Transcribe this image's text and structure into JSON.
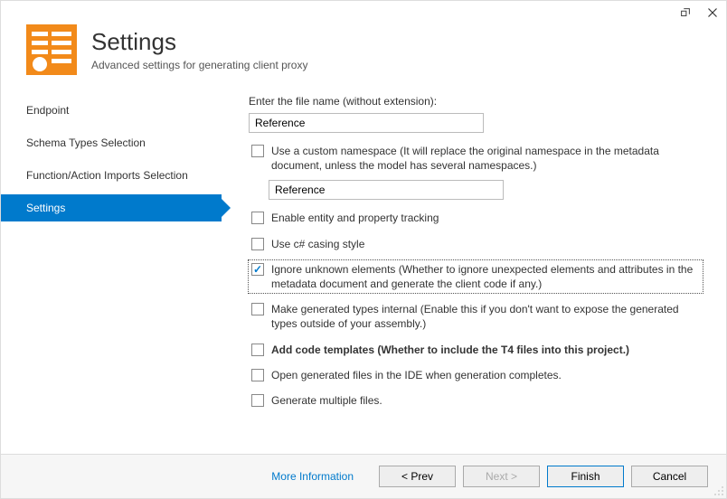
{
  "header": {
    "title": "Settings",
    "subtitle": "Advanced settings for generating client proxy"
  },
  "sidebar": {
    "items": [
      {
        "label": "Endpoint"
      },
      {
        "label": "Schema Types Selection"
      },
      {
        "label": "Function/Action Imports Selection"
      },
      {
        "label": "Settings"
      }
    ],
    "active_index": 3
  },
  "content": {
    "file_label": "Enter the file name (without extension):",
    "file_value": "Reference",
    "options": [
      {
        "key": "custom_ns",
        "label": "Use a custom namespace (It will replace the original namespace in the metadata document, unless the model has several namespaces.)",
        "checked": false,
        "input_value": "Reference"
      },
      {
        "key": "tracking",
        "label": "Enable entity and property tracking",
        "checked": false
      },
      {
        "key": "casing",
        "label": "Use c# casing style",
        "checked": false
      },
      {
        "key": "ignore",
        "label": "Ignore unknown elements (Whether to ignore unexpected elements and attributes in the metadata document and generate the client code if any.)",
        "checked": true,
        "focused": true
      },
      {
        "key": "internal",
        "label": "Make generated types internal (Enable this if you don't want to expose the generated types outside of your assembly.)",
        "checked": false
      },
      {
        "key": "templates",
        "label": "Add code templates (Whether to include the T4 files into this project.)",
        "checked": false,
        "bold": true
      },
      {
        "key": "open",
        "label": "Open generated files in the IDE when generation completes.",
        "checked": false
      },
      {
        "key": "multi",
        "label": "Generate multiple files.",
        "checked": false
      }
    ]
  },
  "footer": {
    "more_info": "More Information",
    "prev": "< Prev",
    "next": "Next >",
    "finish": "Finish",
    "cancel": "Cancel"
  }
}
